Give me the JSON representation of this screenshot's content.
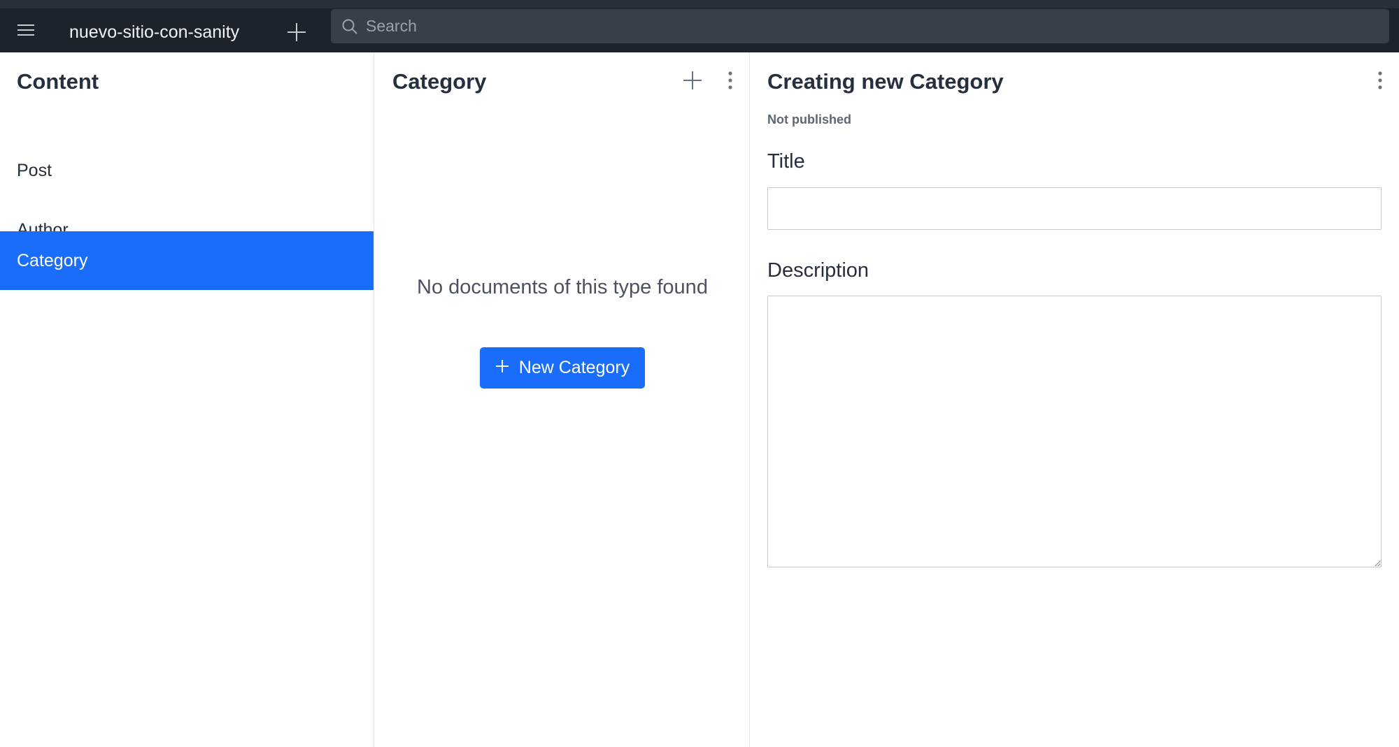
{
  "topbar": {
    "menu_icon": "hamburger-icon",
    "app_title": "nuevo-sitio-con-sanity",
    "new_icon": "plus-icon",
    "search": {
      "placeholder": "Search",
      "value": "",
      "icon": "search-icon"
    }
  },
  "content_pane": {
    "title": "Content",
    "items": [
      {
        "label": "Post",
        "active": false
      },
      {
        "label": "Author",
        "active": false
      },
      {
        "label": "Category",
        "active": true
      }
    ]
  },
  "list_pane": {
    "title": "Category",
    "add_icon": "plus-icon",
    "menu_icon": "kebab-menu-icon",
    "empty_message": "No documents of this type found",
    "new_button_label": "New Category"
  },
  "editor_pane": {
    "title": "Creating new Category",
    "menu_icon": "kebab-menu-icon",
    "status": "Not published",
    "fields": {
      "title_label": "Title",
      "title_value": "",
      "description_label": "Description",
      "description_value": ""
    }
  },
  "colors": {
    "topbar_bg": "#1d232b",
    "search_bg": "#393f47",
    "accent": "#1a6dfb",
    "text": "#262f3d"
  }
}
